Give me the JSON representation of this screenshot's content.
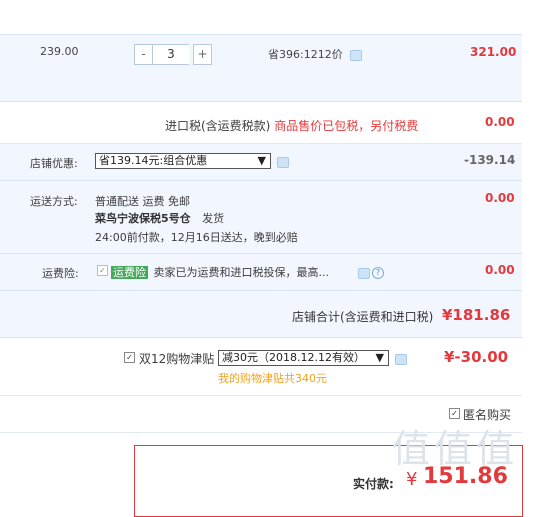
{
  "item": {
    "unit_price": "239.00",
    "quantity": "3",
    "minus": "-",
    "plus": "+",
    "save_note": "省396:1212价",
    "subtotal": "321.00"
  },
  "import_tax": {
    "label": "进口税(含运费税款)",
    "note": "商品售价已包税，另付税费",
    "value": "0.00"
  },
  "store_discount": {
    "label": "店铺优惠:",
    "selected": "省139.14元:组合优惠",
    "value": "-139.14"
  },
  "shipping": {
    "label": "运送方式:",
    "method": "普通配送 运费 免邮",
    "warehouse": "菜鸟宁波保税5号仓",
    "warehouse_suffix": "发货",
    "timing": "24:00前付款，12月16日送达，晚到必赔",
    "value": "0.00"
  },
  "shipping_insurance": {
    "label": "运费险:",
    "tag": "运费险",
    "text": "卖家已为运费和进口税投保，最高...",
    "value": "0.00"
  },
  "store_total": {
    "label": "店铺合计(含运费和进口税)",
    "value": "¥181.86"
  },
  "subsidy": {
    "label": "双12购物津贴",
    "selected": "减30元（2018.12.12有效）",
    "available": "我的购物津贴共340元",
    "value": "¥-30.00"
  },
  "anonymous": {
    "label": "匿名购买"
  },
  "payment": {
    "label": "实付款:",
    "currency": "¥",
    "amount": "151.86"
  },
  "watermark": "值 值 值",
  "colors": {
    "accent_red": "#e4393c",
    "panel_bg": "#f2f7ff",
    "subsidy_orange": "#f0a21f"
  }
}
